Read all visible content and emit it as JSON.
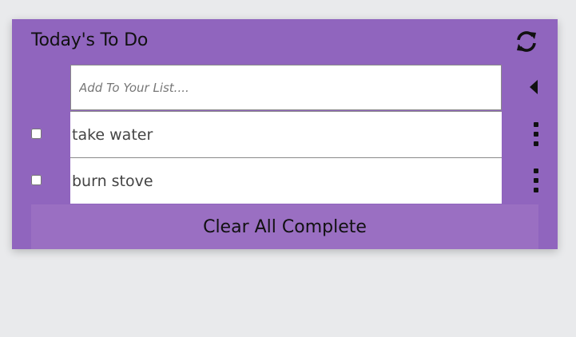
{
  "header": {
    "title": "Today's To Do",
    "refresh_icon": "refresh-icon"
  },
  "new_item": {
    "placeholder": "Add To Your List....",
    "value": "",
    "collapse_icon": "caret-left-icon"
  },
  "todos": [
    {
      "text": "take water",
      "checked": false,
      "menu_icon": "vertical-ellipsis-icon"
    },
    {
      "text": "burn stove",
      "checked": false,
      "menu_icon": "vertical-ellipsis-icon"
    }
  ],
  "footer": {
    "clear_label": "Clear All Complete"
  },
  "colors": {
    "page_background": "#e9eaec",
    "card_background": "#9065be",
    "button_background": "#9a6fc2",
    "field_background": "#ffffff"
  }
}
